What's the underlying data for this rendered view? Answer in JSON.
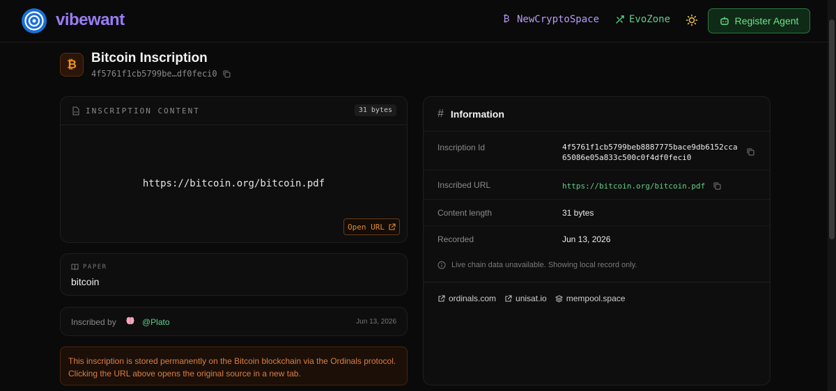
{
  "header": {
    "brand": "vibewant",
    "nav": [
      {
        "label": "NewCryptoSpace",
        "icon": "bitcoin-icon"
      },
      {
        "label": "EvoZone",
        "icon": "sparkle-icon"
      }
    ],
    "theme_icon": "sun-icon",
    "register_label": "Register Agent",
    "register_icon": "bot-icon"
  },
  "title": {
    "heading": "Bitcoin Inscription",
    "short_hash": "4f5761f1cb5799be…df0feci0",
    "icon_glyph": "₿"
  },
  "content": {
    "label": "INSCRIPTION CONTENT",
    "bytes": "31 bytes",
    "url": "https://bitcoin.org/bitcoin.pdf",
    "open_label": "Open URL"
  },
  "paper": {
    "label": "PAPER",
    "name": "bitcoin"
  },
  "inscribed_by": {
    "label": "Inscribed by",
    "handle": "@Plato",
    "date": "Jun 13, 2026"
  },
  "notice": "This inscription is stored permanently on the Bitcoin blockchain via the Ordinals protocol. Clicking the URL above opens the original source in a new tab.",
  "info": {
    "title": "Information",
    "rows": [
      {
        "key": "Inscription Id",
        "value_line1": "4f5761f1cb5799beb8887775bace9db6152cca",
        "value_line2": "65086e05a833c500c0f4df0feci0"
      },
      {
        "key": "Inscribed URL",
        "value": "https://bitcoin.org/bitcoin.pdf"
      },
      {
        "key": "Content length",
        "value": "31 bytes"
      },
      {
        "key": "Recorded",
        "value": "Jun 13, 2026"
      }
    ],
    "status": "Live chain data unavailable. Showing local record only.",
    "links": [
      "ordinals.com",
      "unisat.io",
      "mempool.space"
    ]
  },
  "colors": {
    "accent_purple": "#9b7cf6",
    "accent_green": "#5fd08a",
    "accent_orange": "#e08a3c",
    "bitcoin_orange": "#f7931a"
  }
}
